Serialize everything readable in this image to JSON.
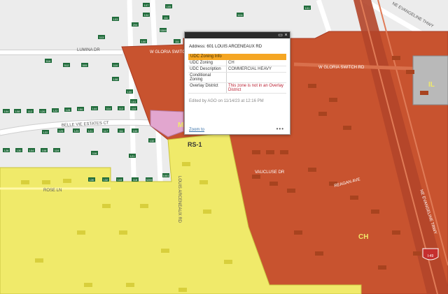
{
  "map": {
    "streets": [
      "LUMINA DR",
      "BELLE VIE ESTATES CT",
      "ROSE LN",
      "W GLORIA SWITCH RD",
      "LOUIS ARCENEAUX RD",
      "VAUCLUSE DR",
      "REAGAN AVE",
      "NE EVANGELINE TRWY",
      "NE EVANGELINE THWY"
    ],
    "zones": [
      "RS-1",
      "CH",
      "IL",
      "M"
    ],
    "route_shield": "I-49",
    "colors": {
      "ch": "#c8532f",
      "ch_dark": "#b3452a",
      "rs1": "#f0ea6a",
      "il": "#b9b9b9",
      "mx": "#e2a6cf",
      "bg": "#ececec"
    },
    "parcel_labels": [
      "107",
      "105",
      "104",
      "111",
      "103",
      "204",
      "3309",
      "1111",
      "101",
      "113",
      "100",
      "111",
      "516",
      "512",
      "505",
      "110",
      "108",
      "100",
      "101",
      "104",
      "108",
      "112",
      "120",
      "122",
      "128",
      "150",
      "144",
      "114",
      "112",
      "110",
      "122",
      "125",
      "123",
      "121",
      "117",
      "111",
      "100",
      "132",
      "128",
      "130",
      "104",
      "108",
      "119",
      "116",
      "121",
      "130",
      "132",
      "144",
      "118",
      "3205",
      "1001",
      "1010",
      "1015"
    ]
  },
  "popup": {
    "address": "Address: 601 LOUIS ARCENEAUX RD",
    "section_title": "UDC Zoning Info",
    "rows": [
      {
        "label": "UDC Zoning",
        "value": "CH"
      },
      {
        "label": "UDC Description",
        "value": "COMMERCIAL HEAVY"
      },
      {
        "label": "Conditional Zoning",
        "value": ""
      },
      {
        "label": "Overlay District",
        "value": "This zone is not in an Overlay District"
      }
    ],
    "edited": "Edited by AGO on 11/14/23 at 12:16 PM",
    "zoom_link": "Zoom to",
    "more": "•••",
    "maximize_icon": "▭",
    "close_icon": "×"
  }
}
